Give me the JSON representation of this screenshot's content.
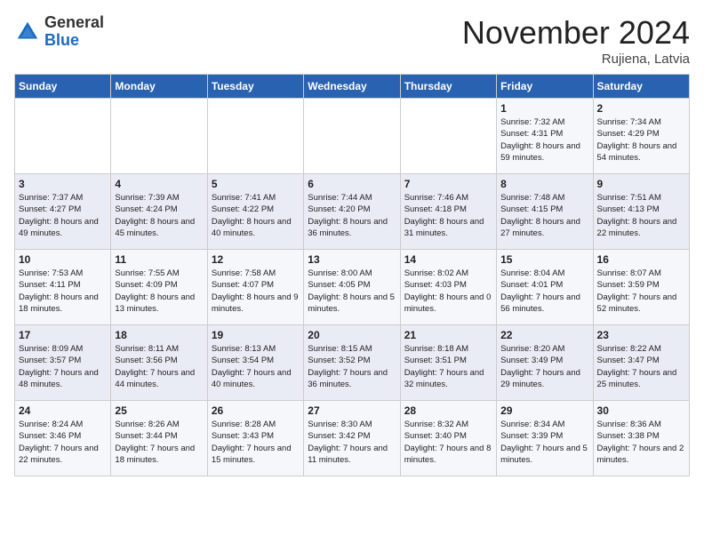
{
  "logo": {
    "general": "General",
    "blue": "Blue"
  },
  "title": "November 2024",
  "location": "Rujiena, Latvia",
  "days_of_week": [
    "Sunday",
    "Monday",
    "Tuesday",
    "Wednesday",
    "Thursday",
    "Friday",
    "Saturday"
  ],
  "weeks": [
    [
      {
        "day": "",
        "info": ""
      },
      {
        "day": "",
        "info": ""
      },
      {
        "day": "",
        "info": ""
      },
      {
        "day": "",
        "info": ""
      },
      {
        "day": "",
        "info": ""
      },
      {
        "day": "1",
        "info": "Sunrise: 7:32 AM\nSunset: 4:31 PM\nDaylight: 8 hours and 59 minutes."
      },
      {
        "day": "2",
        "info": "Sunrise: 7:34 AM\nSunset: 4:29 PM\nDaylight: 8 hours and 54 minutes."
      }
    ],
    [
      {
        "day": "3",
        "info": "Sunrise: 7:37 AM\nSunset: 4:27 PM\nDaylight: 8 hours and 49 minutes."
      },
      {
        "day": "4",
        "info": "Sunrise: 7:39 AM\nSunset: 4:24 PM\nDaylight: 8 hours and 45 minutes."
      },
      {
        "day": "5",
        "info": "Sunrise: 7:41 AM\nSunset: 4:22 PM\nDaylight: 8 hours and 40 minutes."
      },
      {
        "day": "6",
        "info": "Sunrise: 7:44 AM\nSunset: 4:20 PM\nDaylight: 8 hours and 36 minutes."
      },
      {
        "day": "7",
        "info": "Sunrise: 7:46 AM\nSunset: 4:18 PM\nDaylight: 8 hours and 31 minutes."
      },
      {
        "day": "8",
        "info": "Sunrise: 7:48 AM\nSunset: 4:15 PM\nDaylight: 8 hours and 27 minutes."
      },
      {
        "day": "9",
        "info": "Sunrise: 7:51 AM\nSunset: 4:13 PM\nDaylight: 8 hours and 22 minutes."
      }
    ],
    [
      {
        "day": "10",
        "info": "Sunrise: 7:53 AM\nSunset: 4:11 PM\nDaylight: 8 hours and 18 minutes."
      },
      {
        "day": "11",
        "info": "Sunrise: 7:55 AM\nSunset: 4:09 PM\nDaylight: 8 hours and 13 minutes."
      },
      {
        "day": "12",
        "info": "Sunrise: 7:58 AM\nSunset: 4:07 PM\nDaylight: 8 hours and 9 minutes."
      },
      {
        "day": "13",
        "info": "Sunrise: 8:00 AM\nSunset: 4:05 PM\nDaylight: 8 hours and 5 minutes."
      },
      {
        "day": "14",
        "info": "Sunrise: 8:02 AM\nSunset: 4:03 PM\nDaylight: 8 hours and 0 minutes."
      },
      {
        "day": "15",
        "info": "Sunrise: 8:04 AM\nSunset: 4:01 PM\nDaylight: 7 hours and 56 minutes."
      },
      {
        "day": "16",
        "info": "Sunrise: 8:07 AM\nSunset: 3:59 PM\nDaylight: 7 hours and 52 minutes."
      }
    ],
    [
      {
        "day": "17",
        "info": "Sunrise: 8:09 AM\nSunset: 3:57 PM\nDaylight: 7 hours and 48 minutes."
      },
      {
        "day": "18",
        "info": "Sunrise: 8:11 AM\nSunset: 3:56 PM\nDaylight: 7 hours and 44 minutes."
      },
      {
        "day": "19",
        "info": "Sunrise: 8:13 AM\nSunset: 3:54 PM\nDaylight: 7 hours and 40 minutes."
      },
      {
        "day": "20",
        "info": "Sunrise: 8:15 AM\nSunset: 3:52 PM\nDaylight: 7 hours and 36 minutes."
      },
      {
        "day": "21",
        "info": "Sunrise: 8:18 AM\nSunset: 3:51 PM\nDaylight: 7 hours and 32 minutes."
      },
      {
        "day": "22",
        "info": "Sunrise: 8:20 AM\nSunset: 3:49 PM\nDaylight: 7 hours and 29 minutes."
      },
      {
        "day": "23",
        "info": "Sunrise: 8:22 AM\nSunset: 3:47 PM\nDaylight: 7 hours and 25 minutes."
      }
    ],
    [
      {
        "day": "24",
        "info": "Sunrise: 8:24 AM\nSunset: 3:46 PM\nDaylight: 7 hours and 22 minutes."
      },
      {
        "day": "25",
        "info": "Sunrise: 8:26 AM\nSunset: 3:44 PM\nDaylight: 7 hours and 18 minutes."
      },
      {
        "day": "26",
        "info": "Sunrise: 8:28 AM\nSunset: 3:43 PM\nDaylight: 7 hours and 15 minutes."
      },
      {
        "day": "27",
        "info": "Sunrise: 8:30 AM\nSunset: 3:42 PM\nDaylight: 7 hours and 11 minutes."
      },
      {
        "day": "28",
        "info": "Sunrise: 8:32 AM\nSunset: 3:40 PM\nDaylight: 7 hours and 8 minutes."
      },
      {
        "day": "29",
        "info": "Sunrise: 8:34 AM\nSunset: 3:39 PM\nDaylight: 7 hours and 5 minutes."
      },
      {
        "day": "30",
        "info": "Sunrise: 8:36 AM\nSunset: 3:38 PM\nDaylight: 7 hours and 2 minutes."
      }
    ]
  ]
}
